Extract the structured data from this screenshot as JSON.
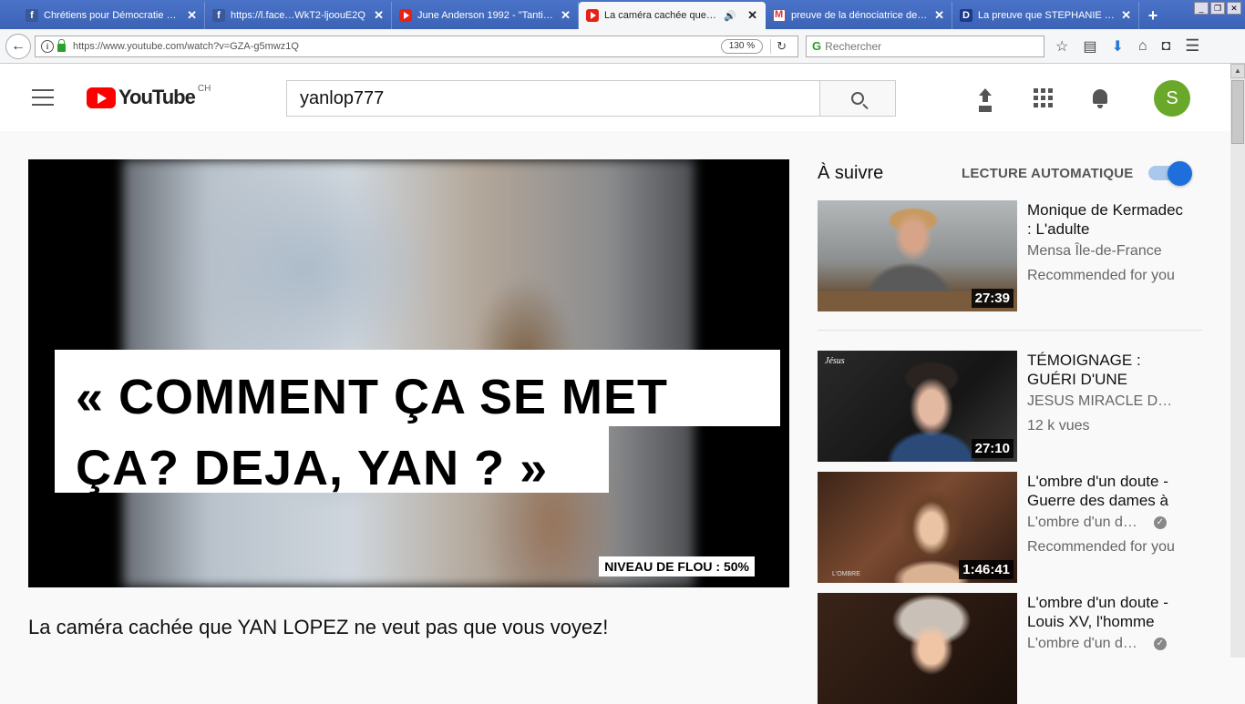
{
  "browser": {
    "tabs": [
      {
        "icon": "facebook-icon",
        "title": "Chrétiens pour Démocratie dir…",
        "active": false
      },
      {
        "icon": "facebook-icon",
        "title": "https://l.face…WkT2-ljoouE2Q",
        "active": false
      },
      {
        "icon": "youtube-icon",
        "title": "June Anderson 1992 - \"Tanti …",
        "active": false
      },
      {
        "icon": "youtube-icon",
        "title": "La caméra cachée que Y…",
        "active": true
      },
      {
        "icon": "gmail-icon",
        "title": "preuve de la dénociatrice de …",
        "active": false
      },
      {
        "icon": "dp-icon",
        "title": "La preuve que STEPHANIE …",
        "active": false
      }
    ],
    "url": "https://www.youtube.com/watch?v=GZA-g5mwz1Q",
    "zoom": "130 %",
    "search_placeholder": "Rechercher"
  },
  "youtube": {
    "country": "CH",
    "search_query": "yanlop777",
    "avatar_letter": "S"
  },
  "player": {
    "caption_line1": "« COMMENT ÇA SE MET",
    "caption_line2": "ÇA? DEJA, YAN ? »",
    "blur_label": "NIVEAU DE FLOU : 50%"
  },
  "video_title": "La caméra cachée que YAN LOPEZ ne veut pas que vous voyez!",
  "sidebar": {
    "up_next": "À suivre",
    "autoplay_label": "LECTURE AUTOMATIQUE",
    "autoplay_on": true,
    "accent_color": "#1e6fdc",
    "recommendations": [
      {
        "title": "Monique de Kermadec : L'adulte",
        "channel": "Mensa Île-de-France",
        "meta": "Recommended for you",
        "duration": "27:39",
        "verified": false
      },
      {
        "title": "TÉMOIGNAGE : GUÉRI D'UNE",
        "channel": "JESUS MIRACLE D…",
        "meta": "12 k vues",
        "duration": "27:10",
        "verified": false
      },
      {
        "title": "L'ombre d'un doute - Guerre des dames à",
        "channel": "L'ombre d'un d…",
        "meta": "Recommended for you",
        "duration": "1:46:41",
        "verified": true
      },
      {
        "title": "L'ombre d'un doute - Louis XV, l'homme",
        "channel": "L'ombre d'un d…",
        "meta": "",
        "duration": "",
        "verified": true
      }
    ]
  }
}
